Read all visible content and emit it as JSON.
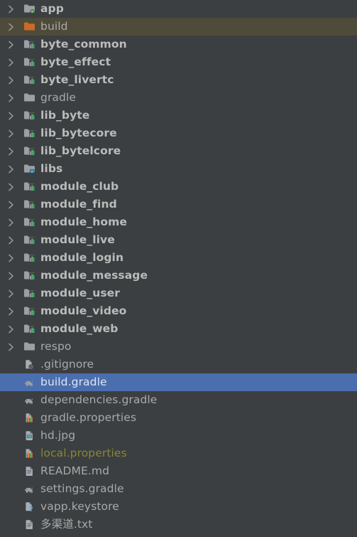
{
  "panel": {
    "name": "project-tree",
    "background_color": "#3c3f41",
    "selection_color": "#4b6eaf",
    "hover_color": "#4e4b3b",
    "text_color": "#a9b7c6",
    "ignored_text_color": "#878734"
  },
  "tree": {
    "items": [
      {
        "label": "app",
        "icon": "folder-module-android-icon",
        "expandable": true,
        "expanded": false,
        "state": "normal",
        "style": "bold"
      },
      {
        "label": "build",
        "icon": "folder-excluded-icon",
        "expandable": true,
        "expanded": false,
        "state": "hovered",
        "style": "plain"
      },
      {
        "label": "byte_common",
        "icon": "folder-module-gradle-icon",
        "expandable": true,
        "expanded": false,
        "state": "normal",
        "style": "bold"
      },
      {
        "label": "byte_effect",
        "icon": "folder-module-gradle-icon",
        "expandable": true,
        "expanded": false,
        "state": "normal",
        "style": "bold"
      },
      {
        "label": "byte_livertc",
        "icon": "folder-module-gradle-icon",
        "expandable": true,
        "expanded": false,
        "state": "normal",
        "style": "bold"
      },
      {
        "label": "gradle",
        "icon": "folder-icon",
        "expandable": true,
        "expanded": false,
        "state": "normal",
        "style": "plain"
      },
      {
        "label": "lib_byte",
        "icon": "folder-module-gradle-icon",
        "expandable": true,
        "expanded": false,
        "state": "normal",
        "style": "bold"
      },
      {
        "label": "lib_bytecore",
        "icon": "folder-module-gradle-icon",
        "expandable": true,
        "expanded": false,
        "state": "normal",
        "style": "bold"
      },
      {
        "label": "lib_bytelcore",
        "icon": "folder-module-gradle-icon",
        "expandable": true,
        "expanded": false,
        "state": "normal",
        "style": "bold"
      },
      {
        "label": "libs",
        "icon": "folder-library-icon",
        "expandable": true,
        "expanded": false,
        "state": "normal",
        "style": "bold"
      },
      {
        "label": "module_club",
        "icon": "folder-module-gradle-icon",
        "expandable": true,
        "expanded": false,
        "state": "normal",
        "style": "bold"
      },
      {
        "label": "module_find",
        "icon": "folder-module-gradle-icon",
        "expandable": true,
        "expanded": false,
        "state": "normal",
        "style": "bold"
      },
      {
        "label": "module_home",
        "icon": "folder-module-gradle-icon",
        "expandable": true,
        "expanded": false,
        "state": "normal",
        "style": "bold"
      },
      {
        "label": "module_live",
        "icon": "folder-module-gradle-icon",
        "expandable": true,
        "expanded": false,
        "state": "normal",
        "style": "bold"
      },
      {
        "label": "module_login",
        "icon": "folder-module-gradle-icon",
        "expandable": true,
        "expanded": false,
        "state": "normal",
        "style": "bold"
      },
      {
        "label": "module_message",
        "icon": "folder-module-gradle-icon",
        "expandable": true,
        "expanded": false,
        "state": "normal",
        "style": "bold"
      },
      {
        "label": "module_user",
        "icon": "folder-module-gradle-icon",
        "expandable": true,
        "expanded": false,
        "state": "normal",
        "style": "bold"
      },
      {
        "label": "module_video",
        "icon": "folder-module-gradle-icon",
        "expandable": true,
        "expanded": false,
        "state": "normal",
        "style": "bold"
      },
      {
        "label": "module_web",
        "icon": "folder-module-gradle-icon",
        "expandable": true,
        "expanded": false,
        "state": "normal",
        "style": "bold"
      },
      {
        "label": "respo",
        "icon": "folder-icon",
        "expandable": true,
        "expanded": false,
        "state": "normal",
        "style": "plain"
      },
      {
        "label": ".gitignore",
        "icon": "file-ignored-icon",
        "expandable": false,
        "expanded": false,
        "state": "normal",
        "style": "plain"
      },
      {
        "label": "build.gradle",
        "icon": "gradle-file-icon",
        "expandable": false,
        "expanded": false,
        "state": "selected",
        "style": "plain"
      },
      {
        "label": "dependencies.gradle",
        "icon": "gradle-file-icon",
        "expandable": false,
        "expanded": false,
        "state": "normal",
        "style": "plain"
      },
      {
        "label": "gradle.properties",
        "icon": "properties-file-icon",
        "expandable": false,
        "expanded": false,
        "state": "normal",
        "style": "plain"
      },
      {
        "label": "hd.jpg",
        "icon": "image-file-icon",
        "expandable": false,
        "expanded": false,
        "state": "normal",
        "style": "plain"
      },
      {
        "label": "local.properties",
        "icon": "properties-file-icon",
        "expandable": false,
        "expanded": false,
        "state": "normal",
        "style": "ignored"
      },
      {
        "label": "README.md",
        "icon": "text-file-icon",
        "expandable": false,
        "expanded": false,
        "state": "normal",
        "style": "plain"
      },
      {
        "label": "settings.gradle",
        "icon": "gradle-file-icon",
        "expandable": false,
        "expanded": false,
        "state": "normal",
        "style": "plain"
      },
      {
        "label": "vapp.keystore",
        "icon": "file-unknown-icon",
        "expandable": false,
        "expanded": false,
        "state": "normal",
        "style": "plain"
      },
      {
        "label": "多渠道.txt",
        "icon": "text-file-icon",
        "expandable": false,
        "expanded": false,
        "state": "normal",
        "style": "plain"
      }
    ]
  }
}
